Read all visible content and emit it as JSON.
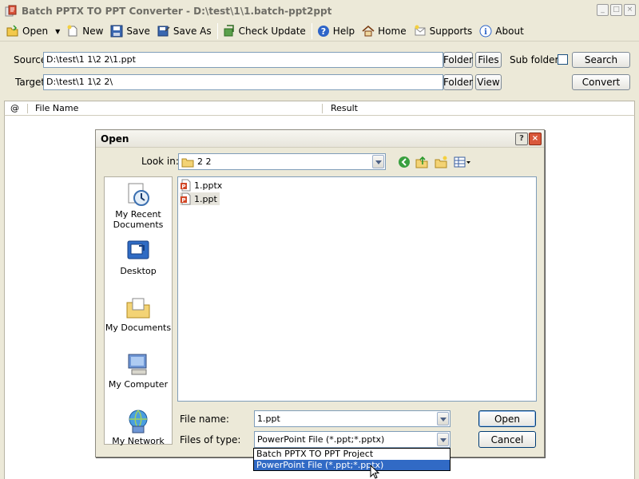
{
  "window": {
    "title": "Batch PPTX TO PPT Converter - D:\\test\\1\\1.batch-ppt2ppt"
  },
  "toolbar": {
    "open": "Open",
    "new": "New",
    "save": "Save",
    "save_as": "Save As",
    "check_update": "Check Update",
    "help": "Help",
    "home": "Home",
    "supports": "Supports",
    "about": "About"
  },
  "panel": {
    "source_label": "Source",
    "source_value": "D:\\test\\1 1\\2 2\\1.ppt",
    "target_label": "Target",
    "target_value": "D:\\test\\1 1\\2 2\\",
    "folder": "Folder",
    "files": "Files",
    "view": "View",
    "sub_folders": "Sub folders",
    "search": "Search",
    "convert": "Convert"
  },
  "grid": {
    "col_at": "@",
    "col_file_name": "File Name",
    "col_result": "Result"
  },
  "dialog": {
    "title": "Open",
    "look_in_label": "Look in:",
    "look_in_value": "2 2",
    "places": [
      {
        "label": "My Recent Documents"
      },
      {
        "label": "Desktop"
      },
      {
        "label": "My Documents"
      },
      {
        "label": "My Computer"
      },
      {
        "label": "My Network"
      }
    ],
    "files": [
      "1.pptx",
      "1.ppt"
    ],
    "file_name_label": "File name:",
    "file_name_value": "1.ppt",
    "file_type_label": "Files of type:",
    "file_type_value": "PowerPoint File (*.ppt;*.pptx)",
    "type_options": [
      "Batch PPTX TO PPT Project",
      "PowerPoint File (*.ppt;*.pptx)"
    ],
    "open_button": "Open",
    "cancel_button": "Cancel"
  }
}
